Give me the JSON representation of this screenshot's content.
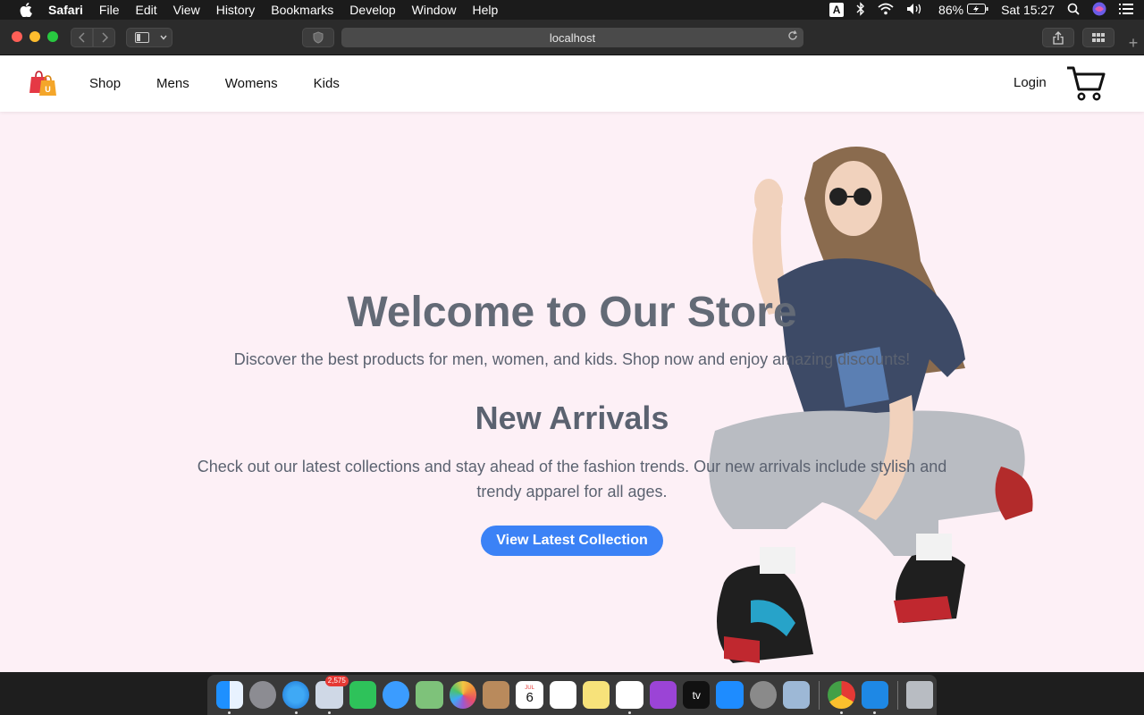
{
  "menubar": {
    "app_name": "Safari",
    "items": [
      "File",
      "Edit",
      "View",
      "History",
      "Bookmarks",
      "Develop",
      "Window",
      "Help"
    ],
    "input_source": "A",
    "battery": "86%",
    "clock": "Sat 15:27"
  },
  "browser": {
    "url": "localhost"
  },
  "site": {
    "nav": [
      "Shop",
      "Mens",
      "Womens",
      "Kids"
    ],
    "login": "Login",
    "logo_letter": "U",
    "hero": {
      "title": "Welcome to Our Store",
      "subtitle": "Discover the best products for men, women, and kids. Shop now and enjoy amazing discounts!",
      "section_title": "New Arrivals",
      "description": "Check out our latest collections and stay ahead of the fashion trends. Our new arrivals include stylish and trendy apparel for all ages.",
      "cta": "View Latest Collection"
    }
  },
  "dock": {
    "mail_badge": "2,575",
    "calendar_day": "6",
    "calendar_month": "JUL",
    "apple_tv_label": "tv"
  },
  "colors": {
    "page_bg": "#fdf0f6",
    "accent": "#3b82f6",
    "heading": "#636a76"
  }
}
